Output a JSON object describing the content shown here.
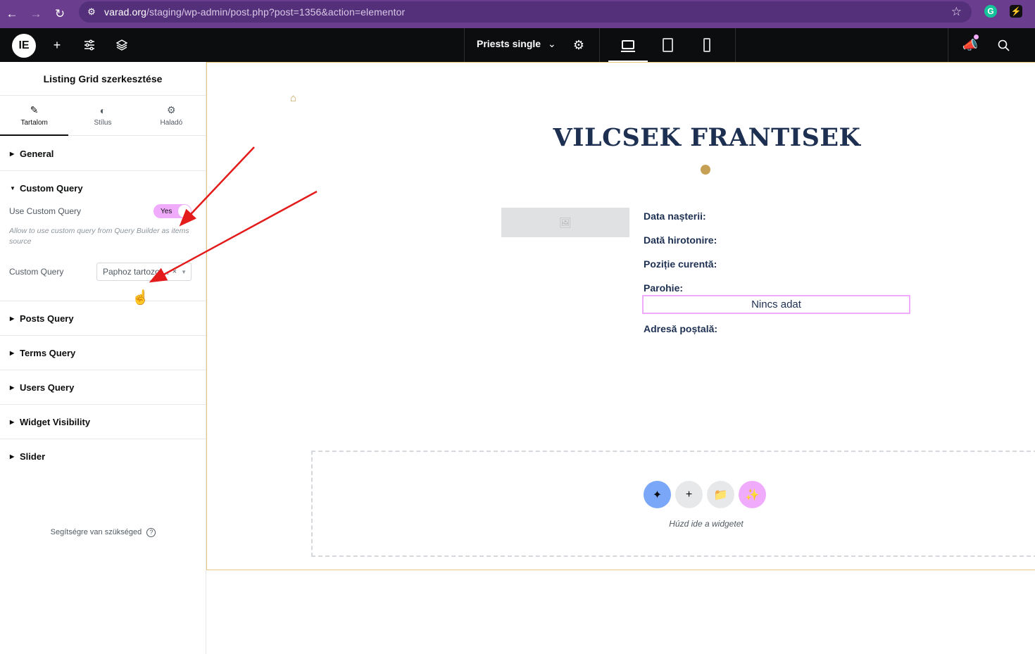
{
  "browser": {
    "url_host": "varad.org",
    "url_path": "/staging/wp-admin/post.php?post=1356&action=elementor"
  },
  "topbar": {
    "doc_name": "Priests single",
    "icons": [
      "elementor-logo-icon",
      "plus-icon",
      "sliders-icon",
      "layers-icon",
      "chevron-down-icon",
      "gear-icon",
      "desktop-icon",
      "tablet-icon",
      "mobile-icon",
      "megaphone-icon",
      "search-icon"
    ]
  },
  "panel": {
    "title": "Listing Grid szerkesztése",
    "tabs": [
      {
        "label": "Tartalom",
        "icon": "pencil-icon",
        "active": true
      },
      {
        "label": "Stílus",
        "icon": "contrast-icon",
        "active": false
      },
      {
        "label": "Haladó",
        "icon": "gear-icon",
        "active": false
      }
    ],
    "sections": {
      "general": "General",
      "custom_query": "Custom Query",
      "posts_query": "Posts Query",
      "terms_query": "Terms Query",
      "users_query": "Users Query",
      "widget_visibility": "Widget Visibility",
      "slider": "Slider"
    },
    "custom_query_body": {
      "use_label": "Use Custom Query",
      "toggle_value": "Yes",
      "description": "Allow to use custom query from Query Builder as items source",
      "query_label": "Custom Query",
      "query_value": "Paphoz tartozo ..."
    },
    "help": "Segítségre van szükséged"
  },
  "canvas": {
    "title": "VILCSEK FRANTISEK",
    "fields": {
      "birth": "Data nașterii:",
      "ordination": "Dată hirotonire:",
      "position": "Poziție curentă:",
      "parish": "Parohie:",
      "address": "Adresă poștală:"
    },
    "no_data": "Nincs adat",
    "drop_hint": "Húzd ide a widgetet"
  }
}
